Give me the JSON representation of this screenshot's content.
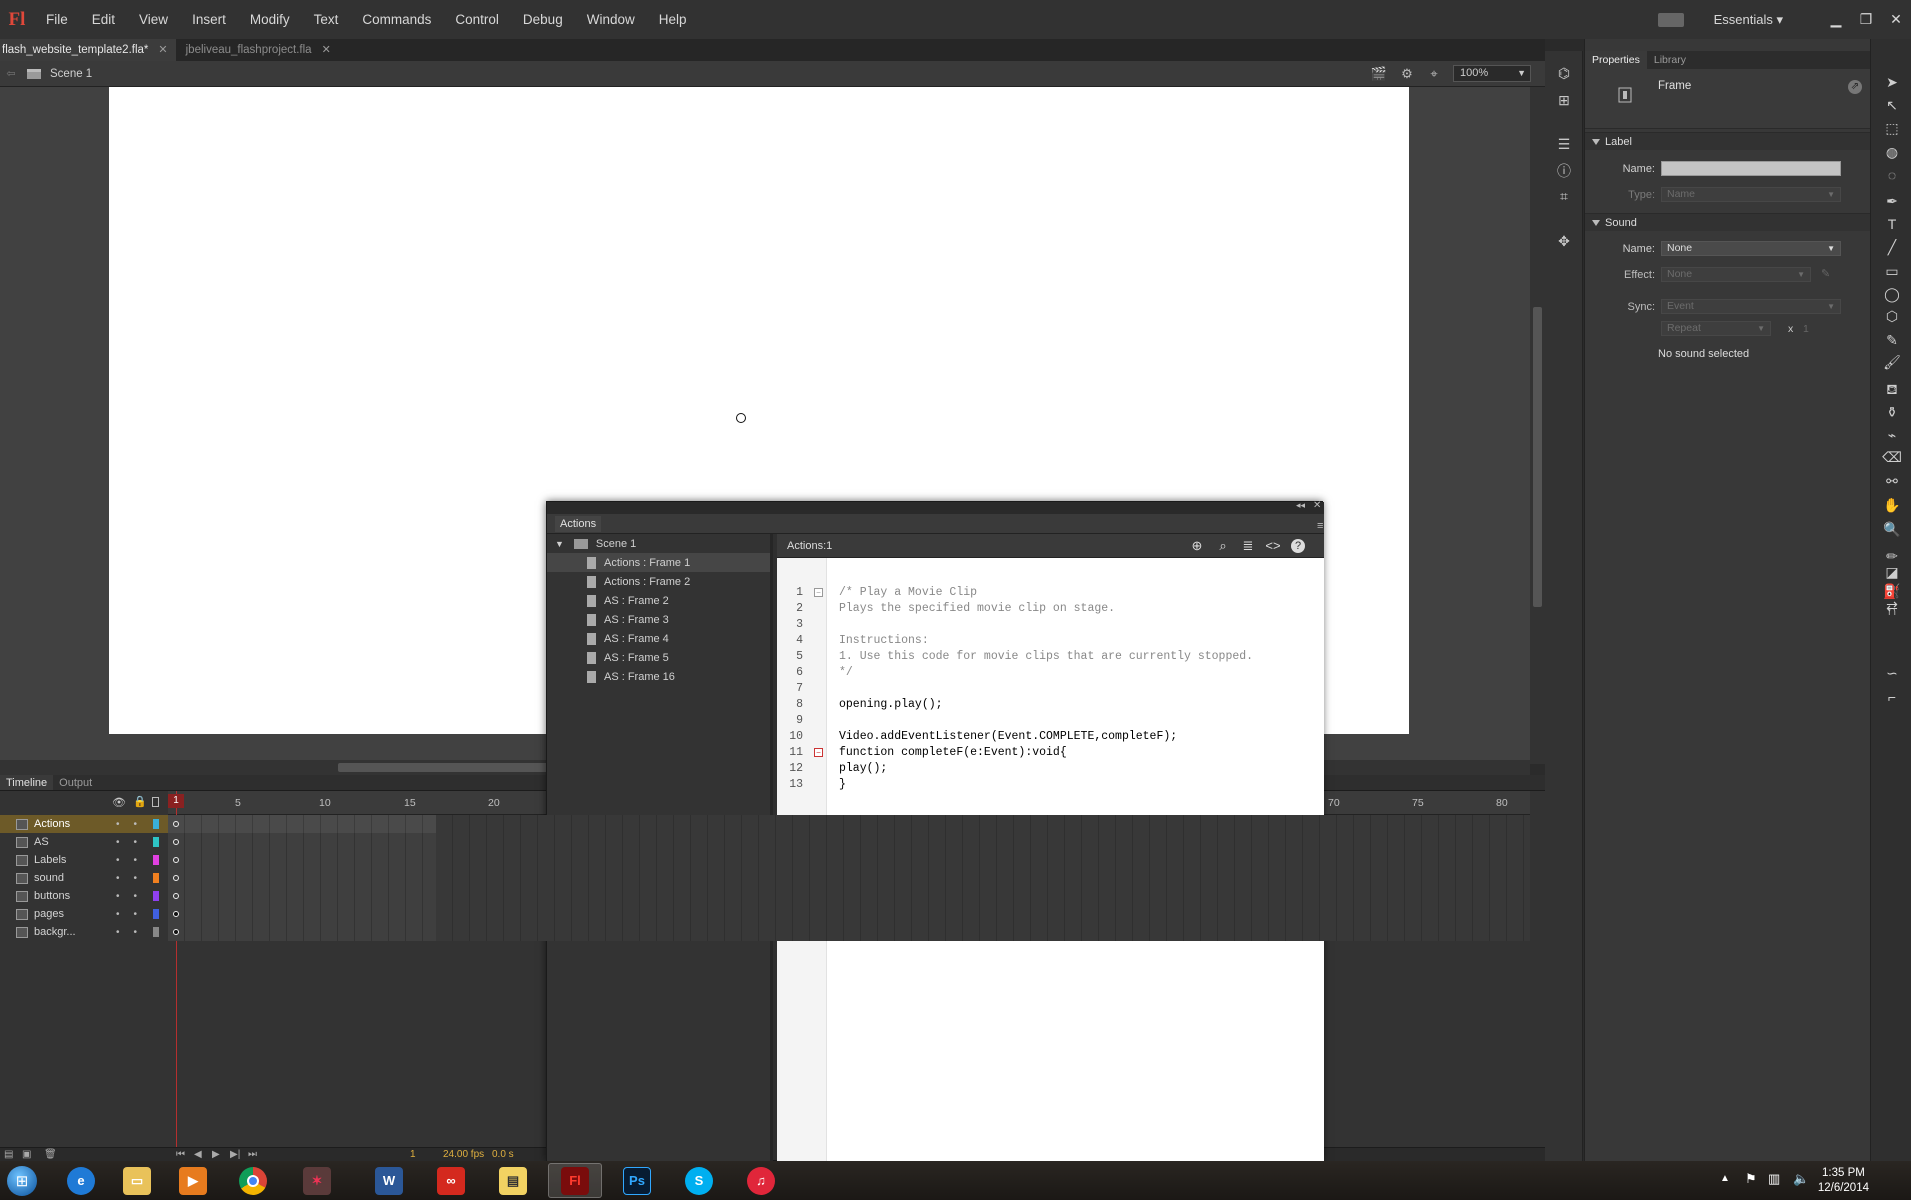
{
  "menu": {
    "logo": "Fl",
    "items": [
      "File",
      "Edit",
      "View",
      "Insert",
      "Modify",
      "Text",
      "Commands",
      "Control",
      "Debug",
      "Window",
      "Help"
    ],
    "workspace": "Essentials"
  },
  "doc_tabs": [
    {
      "label": "flash_website_template2.fla*",
      "active": true
    },
    {
      "label": "jbeliveau_flashproject.fla",
      "active": false
    }
  ],
  "scene": {
    "name": "Scene 1",
    "zoom": "100%"
  },
  "timeline": {
    "tabs": [
      "Timeline",
      "Output"
    ],
    "ruler": [
      "1",
      "5",
      "10",
      "15",
      "20",
      "70",
      "75",
      "80"
    ],
    "layers": [
      {
        "name": "Actions",
        "color": "#3ab0d8",
        "selected": true
      },
      {
        "name": "AS",
        "color": "#2ec4c4",
        "selected": false
      },
      {
        "name": "Labels",
        "color": "#e040e0",
        "selected": false
      },
      {
        "name": "sound",
        "color": "#f08020",
        "selected": false
      },
      {
        "name": "buttons",
        "color": "#9040f0",
        "selected": false
      },
      {
        "name": "pages",
        "color": "#4060e0",
        "selected": false
      },
      {
        "name": "backgr...",
        "color": "#888888",
        "selected": false
      }
    ],
    "footer": {
      "frame": "1",
      "fps": "24.00 fps",
      "time": "0.0 s"
    }
  },
  "actions_panel": {
    "title": "Actions",
    "editor_label": "Actions:1",
    "tree": [
      {
        "label": "Scene 1",
        "level": 0
      },
      {
        "label": "Actions : Frame 1",
        "level": 1,
        "selected": true
      },
      {
        "label": "Actions : Frame 2",
        "level": 1
      },
      {
        "label": "AS : Frame 2",
        "level": 1
      },
      {
        "label": "AS : Frame 3",
        "level": 1
      },
      {
        "label": "AS : Frame 4",
        "level": 1
      },
      {
        "label": "AS : Frame 5",
        "level": 1
      },
      {
        "label": "AS : Frame 16",
        "level": 1
      }
    ],
    "code_lines": [
      "/* Play a Movie Clip",
      "Plays the specified movie clip on stage.",
      "",
      "Instructions:",
      "1. Use this code for movie clips that are currently stopped.",
      "*/",
      "",
      "opening.play();",
      "",
      "Video.addEventListener(Event.COMPLETE,completeF);",
      "function completeF(e:Event):void{",
      "play();",
      "}"
    ]
  },
  "properties": {
    "tabs": [
      "Properties",
      "Library"
    ],
    "type": "Frame",
    "label_section": "Label",
    "name_label": "Name:",
    "type_label": "Type:",
    "type_value": "Name",
    "sound_section": "Sound",
    "sound_name_value": "None",
    "effect_label": "Effect:",
    "effect_value": "None",
    "sync_label": "Sync:",
    "sync_value": "Event",
    "repeat_value": "Repeat",
    "repeat_x": "x",
    "repeat_count": "1",
    "status": "No sound selected"
  },
  "taskbar": {
    "time": "1:35 PM",
    "date": "12/6/2014"
  }
}
